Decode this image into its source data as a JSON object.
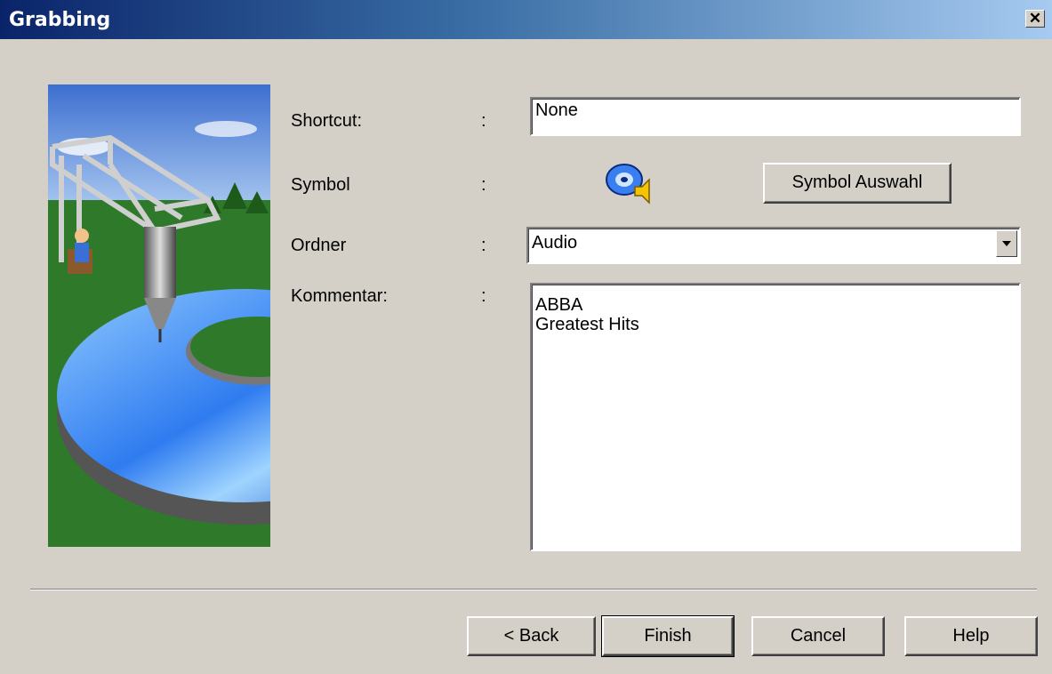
{
  "window": {
    "title": "Grabbing"
  },
  "form": {
    "shortcut": {
      "label": "Shortcut:",
      "value": "None"
    },
    "symbol": {
      "label": "Symbol",
      "button_label": "Symbol Auswahl",
      "icon": "audio-cd-icon"
    },
    "folder": {
      "label": "Ordner",
      "selected": "Audio"
    },
    "comment": {
      "label": "Kommentar:",
      "lines": [
        "ABBA",
        "Greatest Hits"
      ]
    },
    "separator": ":"
  },
  "buttons": {
    "back": "< Back",
    "finish": "Finish",
    "cancel": "Cancel",
    "help": "Help"
  },
  "colors": {
    "title_start": "#0a246a",
    "title_end": "#a6caf0",
    "dialog_bg": "#d4d0c8"
  }
}
